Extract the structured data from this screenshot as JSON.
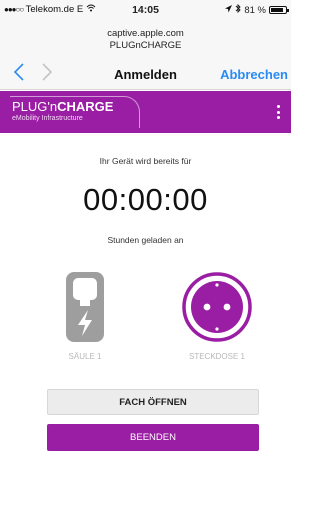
{
  "status_bar": {
    "carrier": "Telekom.de",
    "network": "E",
    "time": "14:05",
    "battery": "81 %",
    "icons": [
      "signal-dots-icon",
      "wifi-icon",
      "location-icon",
      "bluetooth-icon",
      "battery-icon"
    ]
  },
  "url_bar": {
    "host": "captive.apple.com",
    "network_name": "PLUGnCHARGE"
  },
  "nav": {
    "back_icon": "chevron-left-icon",
    "forward_icon": "chevron-right-icon",
    "title": "Anmelden",
    "cancel_label": "Abbrechen"
  },
  "brand": {
    "logo_part1": "PLUG",
    "logo_part2": "'n",
    "logo_part3": "CHARGE",
    "tagline": "eMobility Infrastructure",
    "menu_icon": "more-vertical-icon",
    "color": "#9a1ea3"
  },
  "session": {
    "intro": "Ihr Gerät wird bereits für",
    "elapsed": "00:00:00",
    "outro": "Stunden geladen an"
  },
  "devices": {
    "pillar": {
      "label": "SÄULE 1",
      "icon": "charging-pillar-icon",
      "state_color": "#9e9e9e"
    },
    "socket": {
      "label": "STECKDOSE 1",
      "icon": "power-socket-icon",
      "state_color": "#9a1ea3"
    }
  },
  "actions": {
    "open_label": "FACH ÖFFNEN",
    "end_label": "BEENDEN"
  }
}
